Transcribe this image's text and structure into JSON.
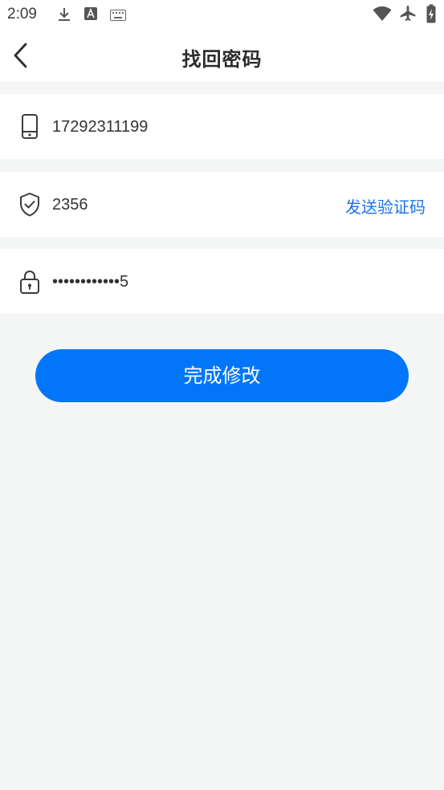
{
  "status_bar": {
    "time": "2:09",
    "left_icons": [
      "download-icon",
      "font-a-icon",
      "keyboard-icon"
    ],
    "right_icons": [
      "wifi-icon",
      "airplane-icon",
      "battery-charging-icon"
    ]
  },
  "header": {
    "title": "找回密码",
    "back_icon": "chevron-left-icon"
  },
  "form": {
    "phone": {
      "icon": "phone-icon",
      "value": "17292311199"
    },
    "code": {
      "icon": "shield-check-icon",
      "value": "2356",
      "send_label": "发送验证码"
    },
    "password": {
      "icon": "lock-icon",
      "value": "••••••••••••5"
    }
  },
  "submit": {
    "label": "完成修改"
  },
  "colors": {
    "accent": "#0276fb",
    "link": "#1a73e8",
    "background": "#f4f6f6",
    "surface": "#ffffff"
  }
}
